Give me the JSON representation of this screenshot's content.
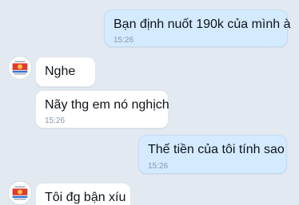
{
  "messages": [
    {
      "side": "sent",
      "text": "Bạn định nuốt 190k của mình à",
      "time": "15:26"
    },
    {
      "side": "recv",
      "text": "Nghe",
      "time": ""
    },
    {
      "side": "recv",
      "text": "Nãy thg em nó nghịch",
      "time": "15:26"
    },
    {
      "side": "sent",
      "text": "Thế tiền của tôi tính sao",
      "time": "15:26"
    },
    {
      "side": "recv",
      "text": "Tôi đg bận xíu",
      "time": ""
    }
  ],
  "contact": {
    "avatar": "organization-logo-avatar-icon"
  },
  "colors": {
    "background": "#e2e9f1",
    "sent_bubble": "#d4eaff",
    "received_bubble": "#ffffff"
  }
}
